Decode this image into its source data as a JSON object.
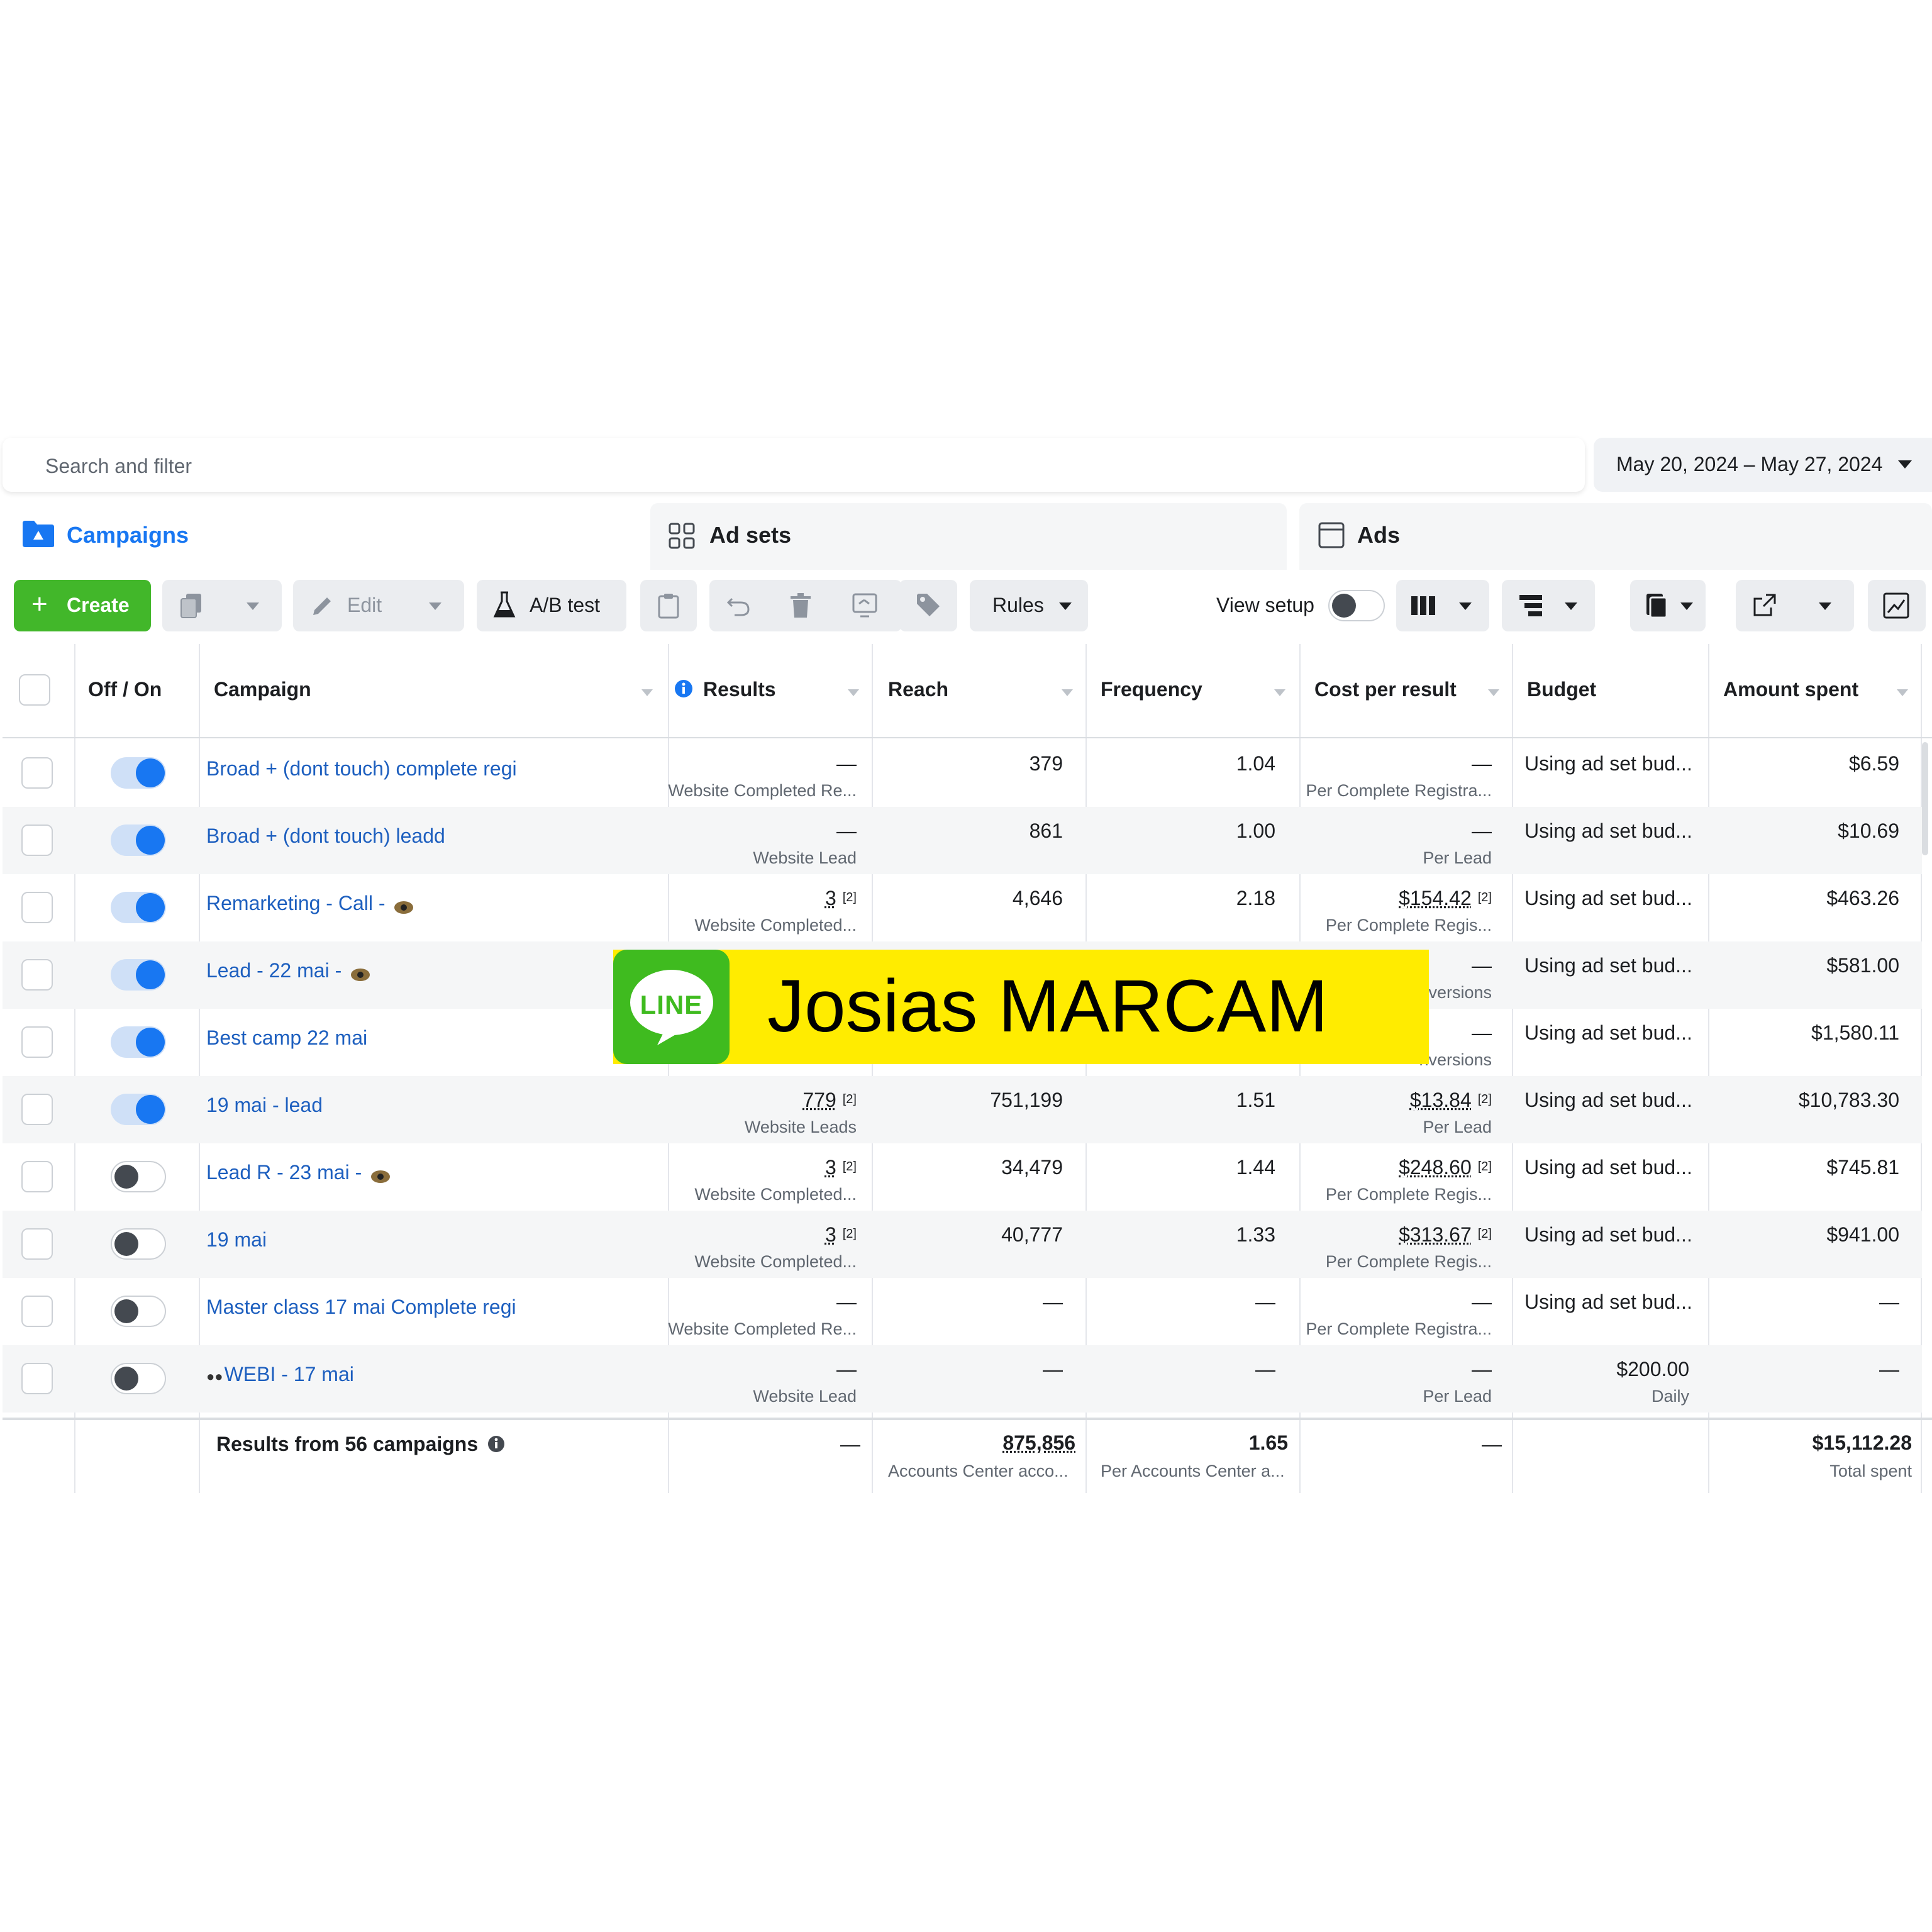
{
  "search": {
    "placeholder": "Search and filter"
  },
  "date_range": {
    "label": "May 20, 2024 – May 27, 2024"
  },
  "tabs": [
    {
      "label": "Campaigns",
      "active": true
    },
    {
      "label": "Ad sets",
      "active": false
    },
    {
      "label": "Ads",
      "active": false
    }
  ],
  "toolbar": {
    "create_label": "Create",
    "edit_label": "Edit",
    "ab_test_label": "A/B test",
    "rules_label": "Rules",
    "view_setup_label": "View setup"
  },
  "columns": {
    "off_on": "Off / On",
    "campaign": "Campaign",
    "results": "Results",
    "reach": "Reach",
    "frequency": "Frequency",
    "cost_per_result": "Cost per result",
    "budget": "Budget",
    "amount_spent": "Amount spent"
  },
  "rows": [
    {
      "on": true,
      "name": "Broad + (dont touch) complete regi",
      "results": "—",
      "results_note": "",
      "results_sub": "Website Completed Re...",
      "reach": "379",
      "frequency": "1.04",
      "cost": "—",
      "cost_note": "",
      "cost_sub": "Per Complete Registra...",
      "budget": "Using ad set bud...",
      "budget_sub": "",
      "spent": "$6.59"
    },
    {
      "on": true,
      "name": "Broad + (dont touch) leadd",
      "results": "—",
      "results_note": "",
      "results_sub": "Website Lead",
      "reach": "861",
      "frequency": "1.00",
      "cost": "—",
      "cost_note": "",
      "cost_sub": "Per Lead",
      "budget": "Using ad set bud...",
      "budget_sub": "",
      "spent": "$10.69"
    },
    {
      "on": true,
      "name": "Remarketing - Call - ",
      "results": "3",
      "results_note": "[2]",
      "results_sub": "Website Completed...",
      "reach": "4,646",
      "frequency": "2.18",
      "cost": "$154.42",
      "cost_note": "[2]",
      "cost_sub": "Per Complete Regis...",
      "budget": "Using ad set bud...",
      "budget_sub": "",
      "spent": "$463.26"
    },
    {
      "on": true,
      "name": "Lead - 22 mai - ",
      "results": "",
      "results_note": "",
      "results_sub": "",
      "reach": "",
      "frequency": "",
      "cost": "—",
      "cost_note": "",
      "cost_sub": "nversions",
      "budget": "Using ad set bud...",
      "budget_sub": "",
      "spent": "$581.00"
    },
    {
      "on": true,
      "name": "Best camp 22 mai",
      "results": "",
      "results_note": "",
      "results_sub": "",
      "reach": "",
      "frequency": "",
      "cost": "—",
      "cost_note": "",
      "cost_sub": "nversions",
      "budget": "Using ad set bud...",
      "budget_sub": "",
      "spent": "$1,580.11"
    },
    {
      "on": true,
      "name": "19 mai - lead",
      "results": "779",
      "results_note": "[2]",
      "results_sub": "Website Leads",
      "reach": "751,199",
      "frequency": "1.51",
      "cost": "$13.84",
      "cost_note": "[2]",
      "cost_sub": "Per Lead",
      "budget": "Using ad set bud...",
      "budget_sub": "",
      "spent": "$10,783.30"
    },
    {
      "on": false,
      "name": "Lead R - 23 mai - ",
      "results": "3",
      "results_note": "[2]",
      "results_sub": "Website Completed...",
      "reach": "34,479",
      "frequency": "1.44",
      "cost": "$248.60",
      "cost_note": "[2]",
      "cost_sub": "Per Complete Regis...",
      "budget": "Using ad set bud...",
      "budget_sub": "",
      "spent": "$745.81"
    },
    {
      "on": false,
      "name": "19 mai",
      "results": "3",
      "results_note": "[2]",
      "results_sub": "Website Completed...",
      "reach": "40,777",
      "frequency": "1.33",
      "cost": "$313.67",
      "cost_note": "[2]",
      "cost_sub": "Per Complete Regis...",
      "budget": "Using ad set bud...",
      "budget_sub": "",
      "spent": "$941.00"
    },
    {
      "on": false,
      "name": "Master class 17 mai Complete regi",
      "results": "—",
      "results_note": "",
      "results_sub": "Website Completed Re...",
      "reach": "—",
      "frequency": "—",
      "cost": "—",
      "cost_note": "",
      "cost_sub": "Per Complete Registra...",
      "budget": "Using ad set bud...",
      "budget_sub": "",
      "spent": "—"
    },
    {
      "on": false,
      "name": "WEBI - 17 mai",
      "results": "—",
      "results_note": "",
      "results_sub": "Website Lead",
      "reach": "—",
      "frequency": "—",
      "cost": "—",
      "cost_note": "",
      "cost_sub": "Per Lead",
      "budget": "$200.00",
      "budget_sub": "Daily",
      "spent": "—"
    }
  ],
  "totals": {
    "label": "Results from 56 campaigns",
    "results": "—",
    "reach": "875,856",
    "reach_sub": "Accounts Center acco...",
    "frequency": "1.65",
    "frequency_sub": "Per Accounts Center a...",
    "cost": "—",
    "spent": "$15,112.28",
    "spent_sub": "Total spent"
  },
  "overlay": {
    "logo_text": "LINE",
    "text": "Josias MARCAM",
    "background": "#ffec00",
    "logo_color": "#3fbb1f"
  },
  "colors": {
    "accent": "#1877f2",
    "create_button": "#42b72a",
    "link": "#1d5fbf"
  }
}
